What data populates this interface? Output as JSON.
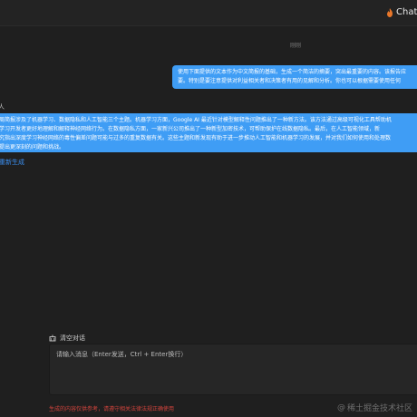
{
  "header": {
    "brand_name": "ChatG",
    "brand_icon": "flame-icon",
    "brand_icon_color": "#e8772a"
  },
  "chat": {
    "timestamp": "刚刚",
    "user_message": {
      "lines": [
        "使用下面提供的文本作为中文简报的基础，生成一个简洁的摘要，突出最重要的内容。该报告应",
        "要。特别是要注意提供对利益相关者和决策者有用的见解和分析。你也可以根据需要使用任何"
      ]
    },
    "assistant": {
      "name": "人",
      "lines": [
        "周简报涉及了机器学习、数据隐私和人工智能三个主题。机器学习方面，Google AI 最近针对模型解释性问题推出了一种新方法。该方法通过高级可视化工具帮助机",
        "学习开发者更好地理解和解释神经网络行为。在数据隐私方面，一家新兴公司推出了一种新型加密技术，可帮助保护在线数据隐私。最后，在人工智能领域，新",
        "究指出深度学习神经网络的毒性偏差问题可能与过多的重复数据有关。这些主题和新发现有助于进一步推动人工智能和机器学习的发展，并对我们如何使用和处理数",
        "提出更深刻的问题和挑战。"
      ]
    },
    "regenerate_label": "重新生成"
  },
  "composer": {
    "clear_label": "清空对话",
    "clear_icon": "broom-icon",
    "placeholder": "请输入消息（Enter发送，Ctrl + Enter换行）"
  },
  "footer": {
    "disclaimer": "生成的内容仅供参考，请遵守相关法律法规正确使用",
    "watermark": "稀土掘金技术社区",
    "watermark_prefix": "@"
  },
  "colors": {
    "accent": "#3f9df5",
    "background": "#1f1f1f",
    "disclaimer": "#d2443d",
    "link": "#3b8ff0"
  }
}
